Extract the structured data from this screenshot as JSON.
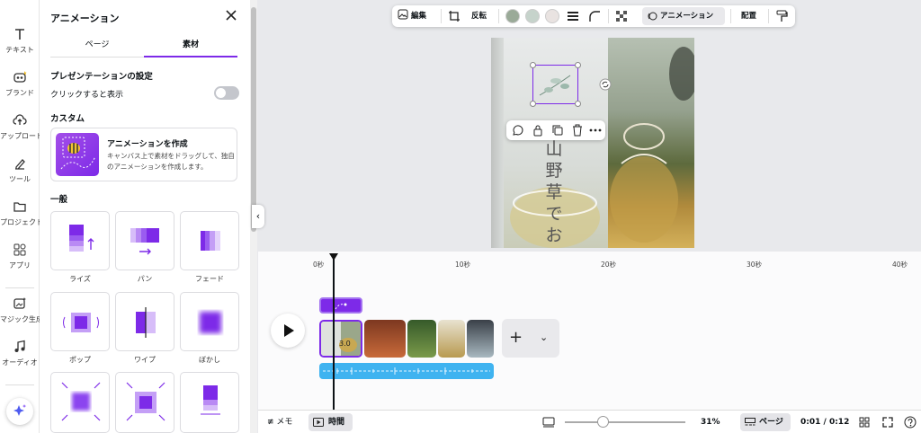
{
  "rail": {
    "items": [
      {
        "label": "テキスト",
        "icon": "text-icon"
      },
      {
        "label": "ブランド",
        "icon": "brand-icon"
      },
      {
        "label": "アップロード",
        "icon": "upload-icon"
      },
      {
        "label": "ツール",
        "icon": "draw-icon"
      },
      {
        "label": "プロジェクト",
        "icon": "folder-icon"
      },
      {
        "label": "アプリ",
        "icon": "apps-icon"
      },
      {
        "label": "マジック生成",
        "icon": "magic-media-icon"
      },
      {
        "label": "オーディオ",
        "icon": "audio-icon"
      }
    ]
  },
  "panel": {
    "title": "アニメーション",
    "tabs": [
      "ページ",
      "素材"
    ],
    "presentation_heading": "プレゼンテーションの設定",
    "click_to_show": "クリックすると表示",
    "custom_heading": "カスタム",
    "create_title": "アニメーションを作成",
    "create_desc": "キャンバス上で素材をドラッグして、独自のアニメーションを作成します。",
    "general_heading": "一般",
    "presets": [
      "ライズ",
      "パン",
      "フェード",
      "ポップ",
      "ワイプ",
      "ぼかし"
    ]
  },
  "toolbar": {
    "edit": "編集",
    "flip": "反転",
    "animation": "アニメーション",
    "position": "配置",
    "colors": [
      "#9aaa98",
      "#c6d3cb",
      "#e9e3e1"
    ]
  },
  "canvas": {
    "vertical_text": "山野草でお茶"
  },
  "timeline": {
    "ruler": [
      "0秒",
      "10秒",
      "20秒",
      "30秒",
      "40秒"
    ],
    "clip_duration": "3.0"
  },
  "bottom": {
    "notes": "メモ",
    "timer": "時間",
    "zoom": "31%",
    "pages": "ページ",
    "time": "0:01 / 0:12"
  },
  "accent": "#7d2ae8"
}
